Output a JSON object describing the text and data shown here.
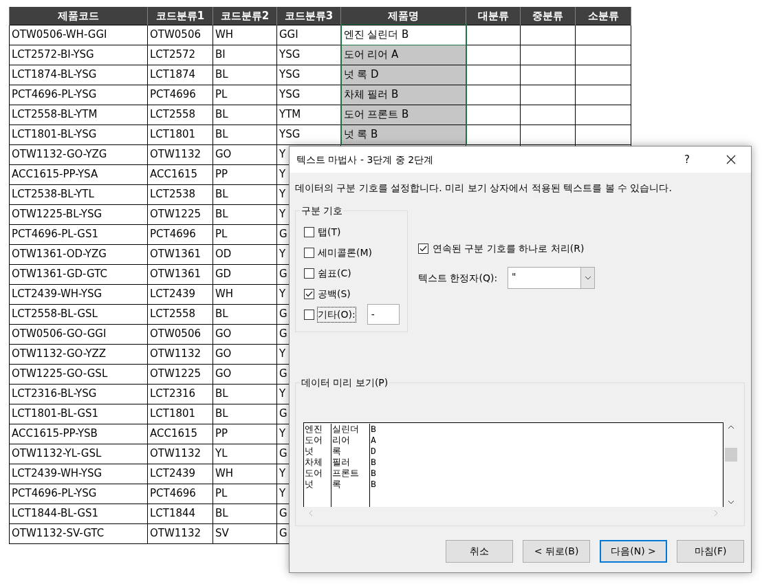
{
  "sheet": {
    "columns": [
      "제품코드",
      "코드분류1",
      "코드분류2",
      "코드분류3",
      "제품명",
      "대분류",
      "중분류",
      "소분류"
    ],
    "rows": [
      {
        "cells": [
          "OTW0506-WH-GGI",
          "OTW0506",
          "WH",
          "GGI"
        ],
        "name": {
          "text": "엔진 실린더 B",
          "selected": true,
          "active": true
        }
      },
      {
        "cells": [
          "LCT2572-BI-YSG",
          "LCT2572",
          "BI",
          "YSG"
        ],
        "name": {
          "text": "도어 리어 A",
          "selected": true,
          "active": false
        }
      },
      {
        "cells": [
          "LCT1874-BL-YSG",
          "LCT1874",
          "BL",
          "YSG"
        ],
        "name": {
          "text": "넛 록 D",
          "selected": true,
          "active": false
        }
      },
      {
        "cells": [
          "PCT4696-PL-YSG",
          "PCT4696",
          "PL",
          "YSG"
        ],
        "name": {
          "text": "차체 필러 B",
          "selected": true,
          "active": false
        }
      },
      {
        "cells": [
          "LCT2558-BL-YTM",
          "LCT2558",
          "BL",
          "YTM"
        ],
        "name": {
          "text": "도어 프론트 B",
          "selected": true,
          "active": false
        }
      },
      {
        "cells": [
          "LCT1801-BL-YSG",
          "LCT1801",
          "BL",
          "YSG"
        ],
        "name": {
          "text": "넛 록 B",
          "selected": true,
          "active": false
        }
      },
      {
        "cells": [
          "OTW1132-GO-YZG",
          "OTW1132",
          "GO",
          "Y"
        ]
      },
      {
        "cells": [
          "ACC1615-PP-YSA",
          "ACC1615",
          "PP",
          "Y"
        ]
      },
      {
        "cells": [
          "LCT2538-BL-YTL",
          "LCT2538",
          "BL",
          "Y"
        ]
      },
      {
        "cells": [
          "OTW1225-BL-YSG",
          "OTW1225",
          "BL",
          "Y"
        ]
      },
      {
        "cells": [
          "PCT4696-PL-GS1",
          "PCT4696",
          "PL",
          "G"
        ]
      },
      {
        "cells": [
          "OTW1361-OD-YZG",
          "OTW1361",
          "OD",
          "Y"
        ]
      },
      {
        "cells": [
          "OTW1361-GD-GTC",
          "OTW1361",
          "GD",
          "G"
        ]
      },
      {
        "cells": [
          "LCT2439-WH-YSG",
          "LCT2439",
          "WH",
          "Y"
        ]
      },
      {
        "cells": [
          "LCT2558-BL-GSL",
          "LCT2558",
          "BL",
          "G"
        ]
      },
      {
        "cells": [
          "OTW0506-GO-GGI",
          "OTW0506",
          "GO",
          "G"
        ]
      },
      {
        "cells": [
          "OTW1132-GO-YZZ",
          "OTW1132",
          "GO",
          "Y"
        ]
      },
      {
        "cells": [
          "OTW1225-GO-GSL",
          "OTW1225",
          "GO",
          "G"
        ]
      },
      {
        "cells": [
          "LCT2316-BL-YSG",
          "LCT2316",
          "BL",
          "Y"
        ]
      },
      {
        "cells": [
          "LCT1801-BL-GS1",
          "LCT1801",
          "BL",
          "G"
        ]
      },
      {
        "cells": [
          "ACC1615-PP-YSB",
          "ACC1615",
          "PP",
          "Y"
        ]
      },
      {
        "cells": [
          "OTW1132-YL-GSL",
          "OTW1132",
          "YL",
          "G"
        ]
      },
      {
        "cells": [
          "LCT2439-WH-YSG",
          "LCT2439",
          "WH",
          "Y"
        ]
      },
      {
        "cells": [
          "PCT4696-PL-YSG",
          "PCT4696",
          "PL",
          "Y"
        ]
      },
      {
        "cells": [
          "LCT1844-BL-GS1",
          "LCT1844",
          "BL",
          "G"
        ]
      },
      {
        "cells": [
          "OTW1132-SV-GTC",
          "OTW1132",
          "SV",
          "G"
        ]
      }
    ]
  },
  "dialog": {
    "title": "텍스트 마법사 - 3단계 중 2단계",
    "help": "?",
    "description": "데이터의 구분 기호를 설정합니다. 미리 보기 상자에서 적용된 텍스트를 볼 수 있습니다.",
    "delimiters": {
      "legend": "구분 기호",
      "items": [
        {
          "label": "탭(T)",
          "checked": false
        },
        {
          "label": "세미콜론(M)",
          "checked": false
        },
        {
          "label": "쉼표(C)",
          "checked": false
        },
        {
          "label": "공백(S)",
          "checked": true
        },
        {
          "label": "기타(O):",
          "checked": false,
          "focused": true,
          "value": "-"
        }
      ]
    },
    "consecutive": {
      "label": "연속된 구분 기호를 하나로 처리(R)",
      "checked": true
    },
    "qualifier": {
      "label": "텍스트 한정자(Q):",
      "value": "\""
    },
    "preview": {
      "legend": "데이터 미리 보기(P)",
      "rows": [
        [
          "엔진",
          "실린더",
          "B"
        ],
        [
          "도어",
          "리어",
          "A"
        ],
        [
          "넛",
          "록",
          "D"
        ],
        [
          "차체",
          "필러",
          "B"
        ],
        [
          "도어",
          "프론트",
          "B"
        ],
        [
          "넛",
          "록",
          "B"
        ]
      ]
    },
    "buttons": [
      {
        "label": "취소",
        "default": false
      },
      {
        "label": "< 뒤로(B)",
        "default": false
      },
      {
        "label": "다음(N) >",
        "default": true
      },
      {
        "label": "마침(F)",
        "default": false
      }
    ]
  }
}
